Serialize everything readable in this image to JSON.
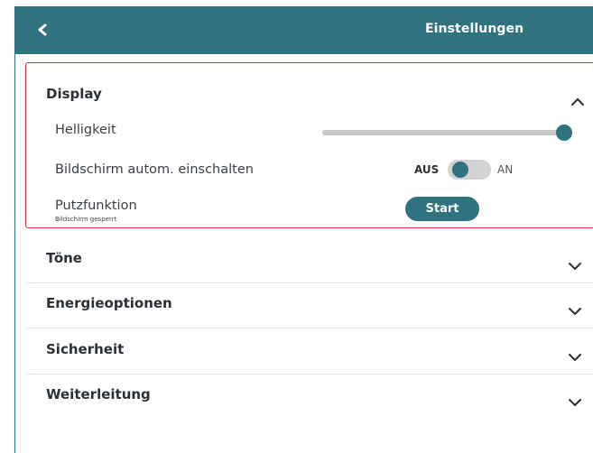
{
  "header": {
    "title": "Einstellungen",
    "back_icon": "chevron-left-icon",
    "color": "#2f7280"
  },
  "display": {
    "title": "Display",
    "expanded": true,
    "rows": {
      "helligkeit": {
        "label": "Helligkeit",
        "slider_level": 1.0
      },
      "auto_on": {
        "label": "Bildschirm autom. einschalten",
        "off_label": "AUS",
        "on_label": "AN",
        "state": "AUS"
      },
      "putz": {
        "label": "Putzfunktion",
        "sublabel": "Bildschirm gesperrt",
        "button": "Start"
      }
    }
  },
  "sections": [
    {
      "label": "Töne"
    },
    {
      "label": "Energieoptionen"
    },
    {
      "label": "Sicherheit"
    },
    {
      "label": "Weiterleitung"
    }
  ],
  "colors": {
    "accent": "#2f7280",
    "highlight_border": "#c9333a"
  }
}
